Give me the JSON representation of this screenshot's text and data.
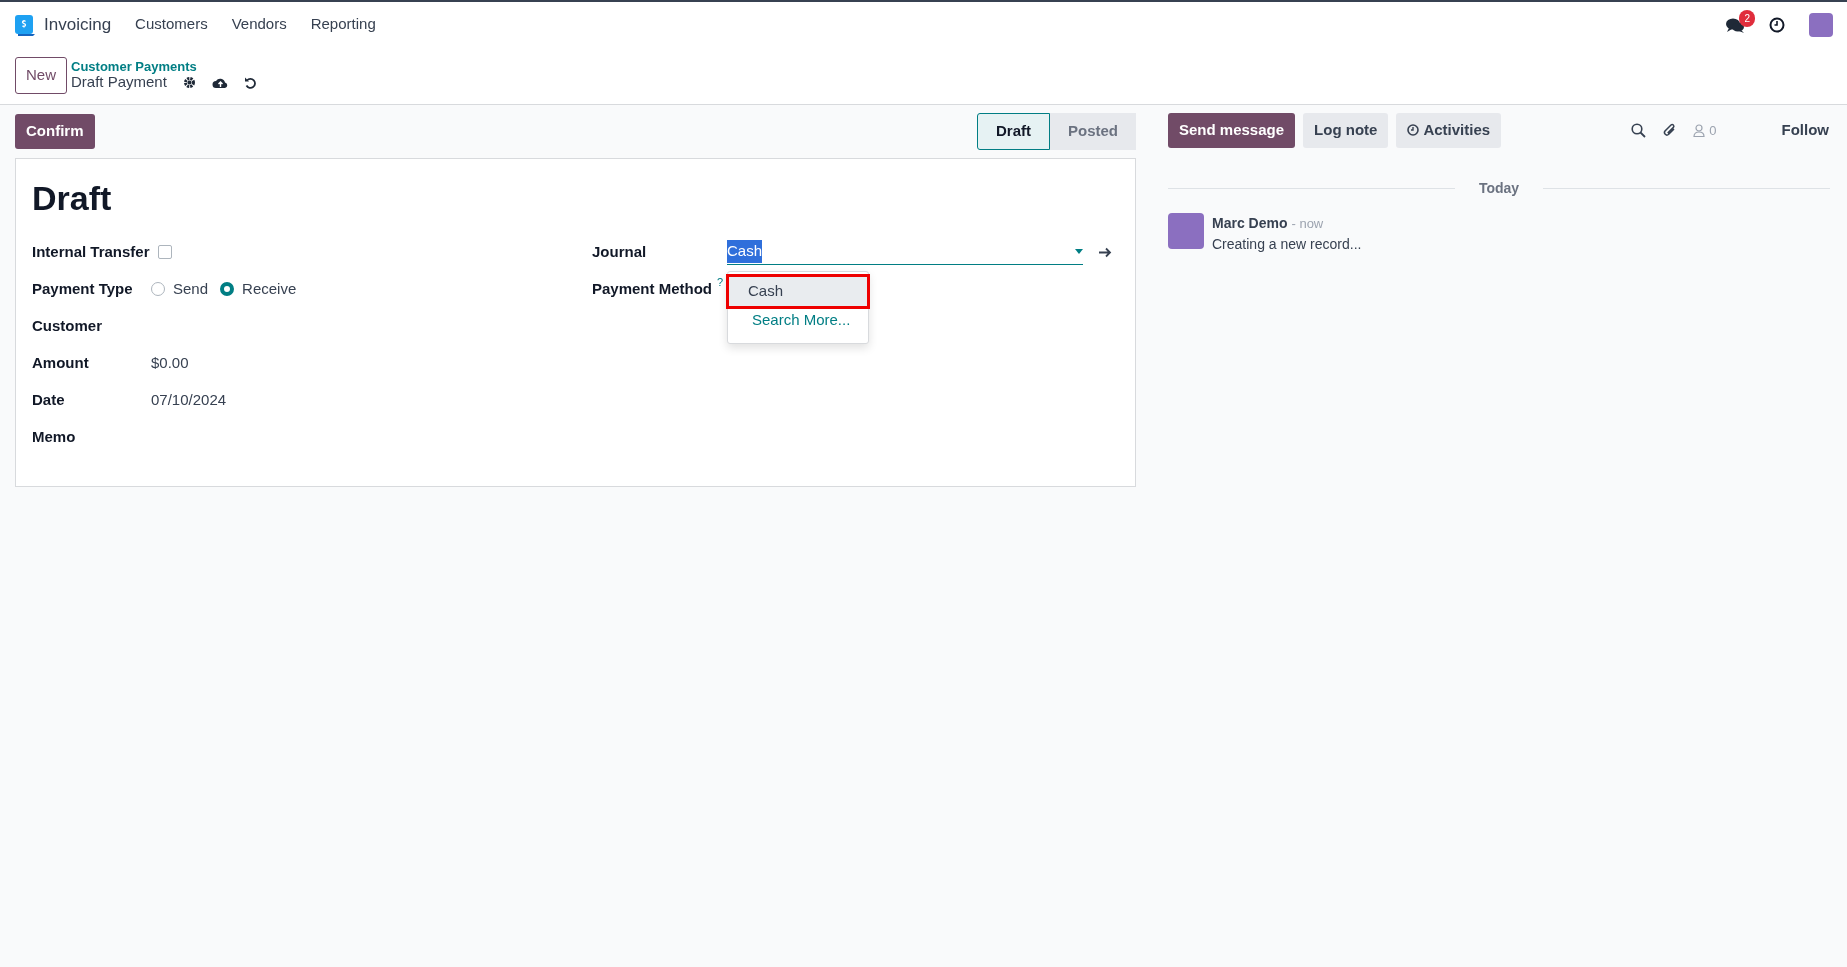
{
  "navbar": {
    "app": "Invoicing",
    "menus": [
      "Customers",
      "Vendors",
      "Reporting"
    ],
    "message_count": "2"
  },
  "control_panel": {
    "new_button": "New",
    "breadcrumb": "Customer Payments",
    "record": "Draft Payment"
  },
  "actions": {
    "confirm": "Confirm"
  },
  "status_steps": [
    {
      "label": "Draft",
      "selected": true
    },
    {
      "label": "Posted",
      "selected": false
    }
  ],
  "form": {
    "title": "Draft",
    "left_fields": [
      {
        "kind": "checkbox",
        "label": "Internal Transfer",
        "checked": false
      },
      {
        "kind": "radio",
        "label": "Payment Type",
        "options": [
          {
            "label": "Send",
            "selected": false
          },
          {
            "label": "Receive",
            "selected": true
          }
        ]
      },
      {
        "kind": "text",
        "label": "Customer"
      },
      {
        "kind": "text",
        "label": "Amount",
        "value": "$0.00"
      },
      {
        "kind": "text",
        "label": "Date",
        "value": "07/10/2024"
      },
      {
        "kind": "text",
        "label": "Memo"
      }
    ],
    "right_fields": [
      {
        "kind": "many2one",
        "label": "Journal",
        "value": "Cash",
        "text_selected": true
      },
      {
        "kind": "text",
        "label": "Payment Method",
        "help": "?"
      }
    ],
    "dropdown": [
      {
        "kind": "option",
        "label": "Cash",
        "highlighted": true
      },
      {
        "kind": "link",
        "label": "Search More...",
        "highlighted": false
      }
    ]
  },
  "chatter": {
    "buttons": [
      {
        "label": "Send message",
        "selected": true
      },
      {
        "label": "Log note",
        "selected": false
      },
      {
        "label": "Activities",
        "selected": false
      }
    ],
    "follower_count": "0",
    "follow": "Follow",
    "date_separator": "Today",
    "messages": [
      {
        "author": "Marc Demo",
        "time": "- now",
        "body": "Creating a new record..."
      }
    ]
  }
}
